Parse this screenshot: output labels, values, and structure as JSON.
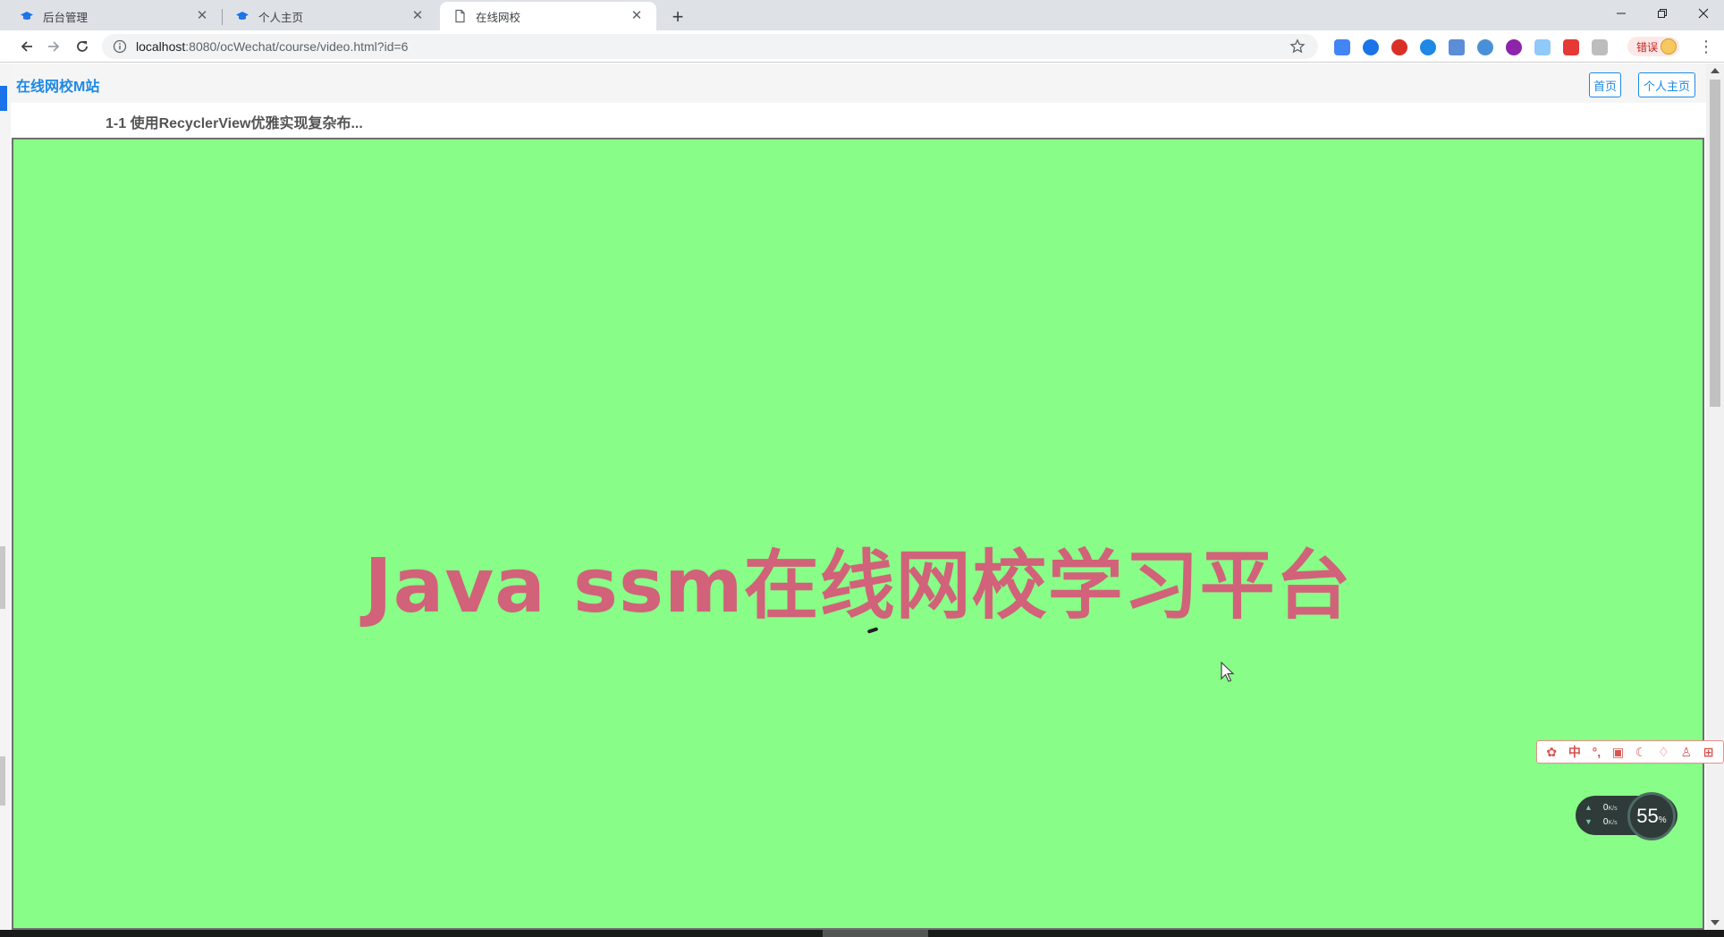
{
  "browser": {
    "tabs": [
      {
        "title": "后台管理",
        "active": false,
        "icon": "graduation-cap-icon"
      },
      {
        "title": "个人主页",
        "active": false,
        "icon": "graduation-cap-icon"
      },
      {
        "title": "在线网校",
        "active": true,
        "icon": "page-icon"
      }
    ],
    "url": {
      "host": "localhost",
      "rest": ":8080/ocWechat/course/video.html?id=6"
    },
    "error_chip": "错误"
  },
  "page": {
    "site_title": "在线网校M站",
    "nav": {
      "home": "首页",
      "profile": "个人主页"
    },
    "lesson_title": "1-1 使用RecyclerView优雅实现复杂布...",
    "video": {
      "overlay_text": "Java ssm在线网校学习平台",
      "background": "#88fd87",
      "text_color": "#d1627a"
    }
  },
  "ime_toolbar": {
    "mode": "中",
    "punct": "°,"
  },
  "network_widget": {
    "upload": "0",
    "download": "0",
    "unit": "K/s",
    "percent": "55",
    "percent_sign": "%"
  }
}
